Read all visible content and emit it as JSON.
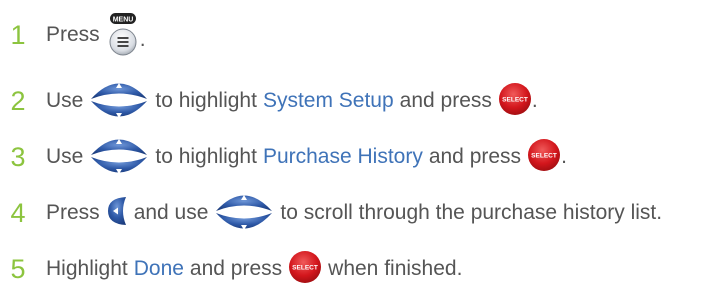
{
  "steps": [
    {
      "number": "1",
      "parts": {
        "a": "Press",
        "b": "."
      },
      "menu_label": "MENU"
    },
    {
      "number": "2",
      "parts": {
        "a": "Use",
        "b": "to highlight",
        "c": "System Setup",
        "d": "and press",
        "e": "."
      },
      "select_label": "SELECT"
    },
    {
      "number": "3",
      "parts": {
        "a": "Use",
        "b": "to highlight",
        "c": "Purchase History",
        "d": "and press",
        "e": "."
      },
      "select_label": "SELECT"
    },
    {
      "number": "4",
      "parts": {
        "a": "Press",
        "b": "and use",
        "c": "to scroll through the purchase history list."
      }
    },
    {
      "number": "5",
      "parts": {
        "a": "Highlight",
        "b": "Done",
        "c": "and press",
        "d": "when finished."
      },
      "select_label": "SELECT"
    }
  ],
  "colors": {
    "number": "#8cc43f",
    "highlight": "#3f73b8",
    "button_red": "#d72025",
    "button_blue": "#2a4f9c",
    "text": "#555555"
  },
  "icons": [
    "menu-button-icon",
    "up-down-arrows-icon",
    "select-button-icon",
    "left-arrow-button-icon"
  ]
}
